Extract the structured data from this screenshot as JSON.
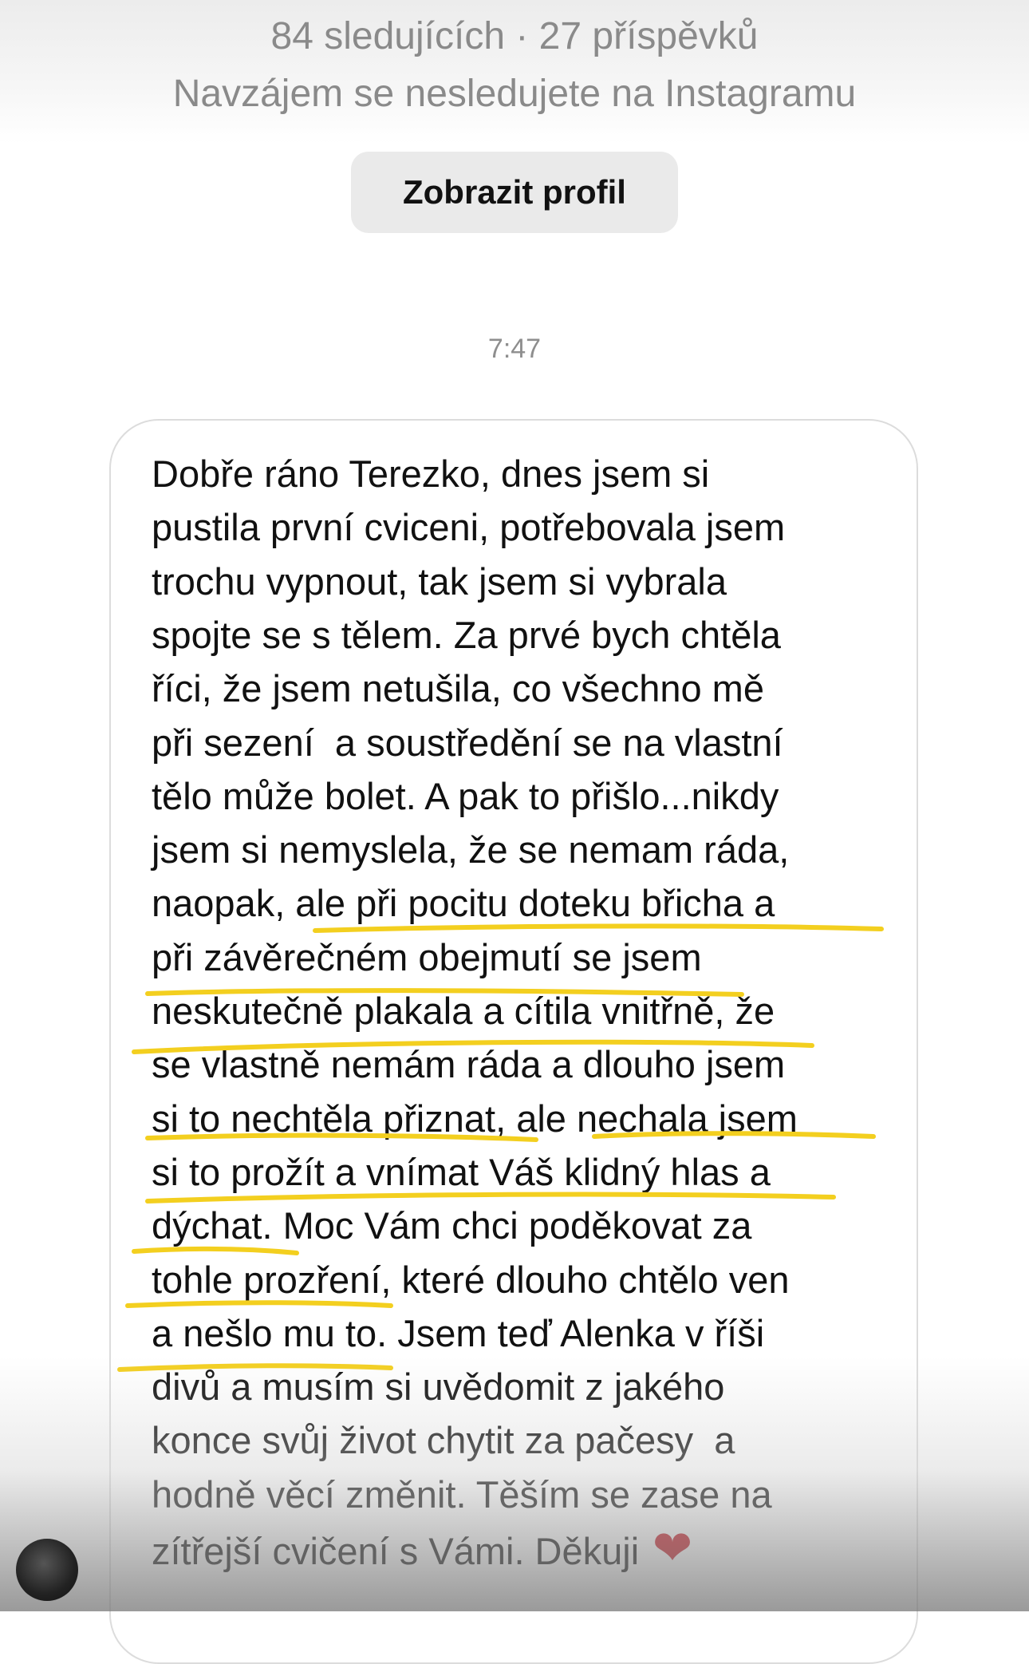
{
  "profile": {
    "stats": "84 sledujících · 27 příspěvků",
    "mutual": "Navzájem se nesledujete na Instagramu",
    "view_profile_label": "Zobrazit profil"
  },
  "chat": {
    "timestamp": "7:47",
    "message_lines": [
      "Dobře ráno Terezko, dnes jsem si",
      "pustila první cviceni, potřebovala jsem",
      "trochu vypnout, tak jsem si vybrala",
      "spojte se s tělem. Za prvé bych chtěla",
      "říci, že jsem netušila, co všechno mě",
      "při sezení  a soustředění se na vlastní",
      "tělo může bolet. A pak to přišlo...nikdy",
      "jsem si nemyslela, že se nemam ráda,",
      "naopak, ale při pocitu doteku břicha a",
      "při závěrečném obejmutí se jsem",
      "neskutečně plakala a cítila vnitřně, že",
      "se vlastně nemám ráda a dlouho jsem",
      "si to nechtěla přiznat, ale nechala jsem",
      "si to prožít a vnímat Váš klidný hlas a",
      "dýchat. Moc Vám chci poděkovat za",
      "tohle prozření, které dlouho chtělo ven",
      "a nešlo mu to. Jsem teď Alenka v říši",
      "divů a musím si uvědomit z jakého",
      "konce svůj život chytit za pačesy  a",
      "hodně věcí změnit. Těším se zase na",
      "zítřejší cvičení s Vámi. Děkuji"
    ],
    "heart_emoji": "❤",
    "highlight_color": "#f3cf1f"
  },
  "icons": {
    "avatar": "user-avatar",
    "heart": "red-heart-emoji"
  }
}
